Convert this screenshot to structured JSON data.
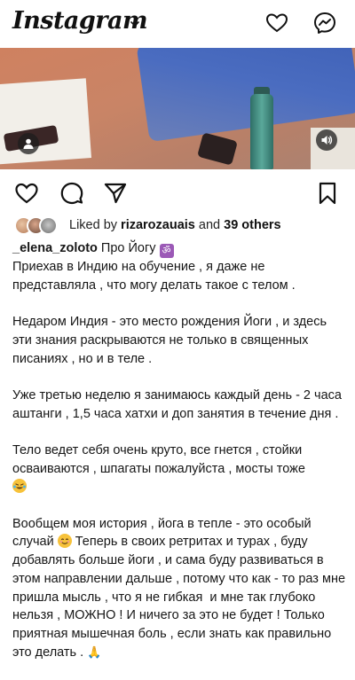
{
  "header": {
    "app_name": "Instagram",
    "icons": [
      "chevron-down-icon",
      "heart-icon",
      "messenger-icon"
    ]
  },
  "media": {
    "buttons": [
      "user-tag-icon",
      "volume-icon"
    ]
  },
  "actions": {
    "icons": [
      "like-icon",
      "comment-icon",
      "share-icon",
      "save-icon"
    ]
  },
  "likes": {
    "prefix": "Liked by ",
    "user": "rizarozauais",
    "and": " and ",
    "others": "39 others"
  },
  "caption": {
    "author": "_elena_zoloto",
    "title": " Про Йогу ",
    "om_symbol": "ॐ",
    "p1": "Приехав в Индию на обучение , я даже не представляла , что могу делать такое с телом .",
    "p2": "Недаром Индия - это место рождения Йоги , и здесь эти знания раскрываются не только в священных писаниях , но и в теле .",
    "p3": "Уже третью неделю я занимаюсь каждый день - 2 часа аштанги , 1,5 часа хатхи и доп занятия в течение дня .",
    "p4": "Тело ведет себя очень круто, все гнется , стойки осваиваются , шпагаты пожалуйста , мосты тоже",
    "p5a": "Вообщем моя история , йога в тепле - это особый случай ",
    "p5b": " Теперь в своих ретритах и турах , буду добавлять больше йоги , и сама буду развиваться в этом направлении дальше , потому что как - то раз мне пришла мысль , что я не гибкая  и мне так глубоко нельзя , МОЖНО ! И ничего за это не будет ! Только приятная мышечная боль , если знать как правильно это делать . ",
    "pray_emoji": "🙏"
  },
  "colors": {
    "om_badge": "#9b59b6",
    "emoji_yellow": "#f7c23a"
  }
}
